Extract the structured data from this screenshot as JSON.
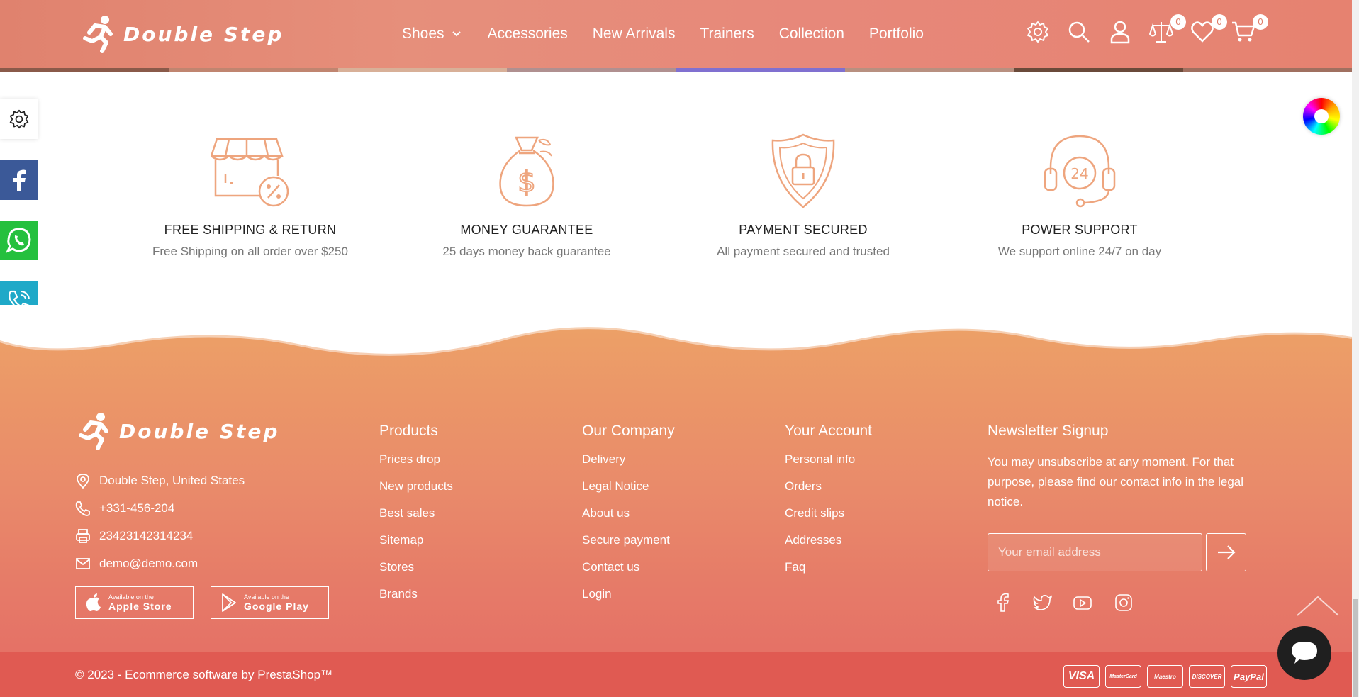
{
  "brand": {
    "name": "Double Step"
  },
  "nav": {
    "items": [
      {
        "label": "Shoes",
        "has_dropdown": true
      },
      {
        "label": "Accessories"
      },
      {
        "label": "New Arrivals"
      },
      {
        "label": "Trainers"
      },
      {
        "label": "Collection"
      },
      {
        "label": "Portfolio"
      }
    ]
  },
  "header_icons": {
    "compare_count": "0",
    "wishlist_count": "0",
    "cart_count": "0"
  },
  "features": [
    {
      "icon": "shop-discount-icon",
      "title": "FREE SHIPPING & RETURN",
      "subtitle": "Free Shipping on all order over $250"
    },
    {
      "icon": "money-bag-icon",
      "title": "MONEY GUARANTEE",
      "subtitle": "25 days money back guarantee"
    },
    {
      "icon": "shield-lock-icon",
      "title": "PAYMENT SECURED",
      "subtitle": "All payment secured and trusted"
    },
    {
      "icon": "headset-24-icon",
      "title": "POWER SUPPORT",
      "subtitle": "We support online 24/7 on day"
    }
  ],
  "footer": {
    "contact": {
      "address": "Double Step, United States",
      "phone": "+331-456-204",
      "fax": "23423142314234",
      "email": "demo@demo.com"
    },
    "apps": {
      "apple_small": "Available on the",
      "apple_big": "Apple Store",
      "google_small": "Available on the",
      "google_big": "Google Play"
    },
    "products": {
      "title": "Products",
      "links": [
        "Prices drop",
        "New products",
        "Best sales",
        "Sitemap",
        "Stores",
        "Brands"
      ]
    },
    "company": {
      "title": "Our Company",
      "links": [
        "Delivery",
        "Legal Notice",
        "About us",
        "Secure payment",
        "Contact us",
        "Login"
      ]
    },
    "account": {
      "title": "Your Account",
      "links": [
        "Personal info",
        "Orders",
        "Credit slips",
        "Addresses",
        "Faq"
      ]
    },
    "newsletter": {
      "title": "Newsletter Signup",
      "text": "You may unsubscribe at any moment. For that purpose, please find our contact info in the legal notice.",
      "placeholder": "Your email address"
    },
    "copyright": "© 2023 - Ecommerce software by PrestaShop™",
    "payments": [
      "VISA",
      "MasterCard",
      "Maestro",
      "DISCOVER",
      "PayPal"
    ]
  },
  "colors": {
    "accent": "#e8907a",
    "footer_top": "#eca167",
    "footer_bottom": "#e46b65",
    "bottom_bar": "#e05a52",
    "icon_line": "#eea57e"
  }
}
